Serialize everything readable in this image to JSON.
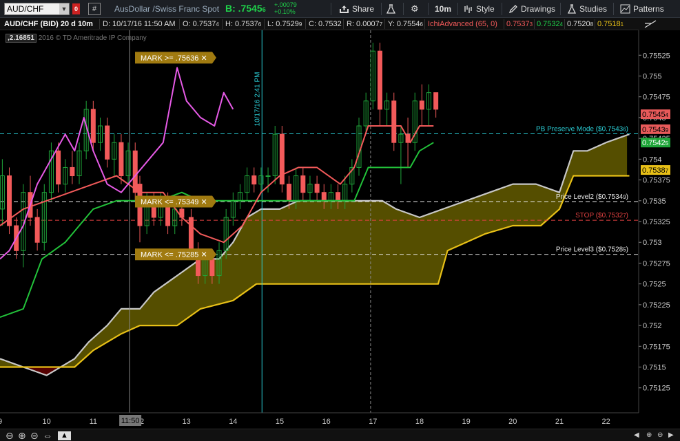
{
  "toolbar": {
    "symbol": "AUD/CHF",
    "link_badge": "0",
    "description": "AusDollar /Swiss Franc Spot",
    "bid_label": "B: .7545",
    "bid_sub": "6",
    "change_abs": "+.00079",
    "change_pct": "+0.10%",
    "share": "Share",
    "period": "10m",
    "style": "Style",
    "drawings": "Drawings",
    "studies": "Studies",
    "patterns": "Patterns"
  },
  "infobar": {
    "title": "AUD/CHF (BID) 20 d 10m",
    "date": "D: 10/17/16 11:50 AM",
    "open": "O: 0.7537",
    "open_sub": "4",
    "high": "H: 0.7537",
    "high_sub": "6",
    "low": "L: 0.7529",
    "low_sub": "9",
    "close": "C: 0.7532",
    "range": "R: 0.0007",
    "range_sub": "7",
    "y": "Y: 0.7554",
    "y_sub": "6",
    "study": "IchiAdvanced (65, 0)",
    "s1": "0.7537",
    "s1_sub": "3",
    "s2": "0.7532",
    "s2_sub": "4",
    "s3": "0.7520",
    "s3_sub": "8",
    "s4": "0.7518",
    "s4_sub": "1"
  },
  "copyright": {
    "value": ",2.16851",
    "text": "2016 © TD Ameritrade IP Company"
  },
  "chart_data": {
    "type": "candlestick",
    "ylim": [
      0.75095,
      0.75555
    ],
    "xlim": [
      9,
      22.7
    ],
    "y_ticks": [
      "0.75525",
      "0.755",
      "0.75475",
      "0.7545",
      "0.75425",
      "0.754",
      "0.75375",
      "0.7535",
      "0.75325",
      "0.753",
      "0.75275",
      "0.7525",
      "0.75225",
      "0.752",
      "0.75175",
      "0.7515",
      "0.75125"
    ],
    "x_ticks": [
      "9",
      "10",
      "11",
      "12",
      "13",
      "14",
      "15",
      "16",
      "17",
      "18",
      "19",
      "20",
      "21",
      "22"
    ],
    "crosshair_x_label": "11:50",
    "vertical_event_label": "10/17/16 2:41 PM",
    "candles": [
      [
        9.05,
        0.7534,
        0.7538,
        0.7532,
        0.754
      ],
      [
        9.2,
        0.7538,
        0.7532,
        0.7531,
        0.7539
      ],
      [
        9.35,
        0.7532,
        0.7529,
        0.7528,
        0.7533
      ],
      [
        9.5,
        0.7529,
        0.7536,
        0.7527,
        0.7537
      ],
      [
        9.65,
        0.7536,
        0.7533,
        0.7532,
        0.7538
      ],
      [
        9.8,
        0.7533,
        0.753,
        0.7529,
        0.7534
      ],
      [
        9.95,
        0.753,
        0.7536,
        0.7529,
        0.7537
      ],
      [
        10.1,
        0.7536,
        0.7541,
        0.7535,
        0.7542
      ],
      [
        10.25,
        0.7541,
        0.7537,
        0.7536,
        0.7542
      ],
      [
        10.4,
        0.7537,
        0.7539,
        0.7536,
        0.754
      ],
      [
        10.55,
        0.7539,
        0.7538,
        0.7537,
        0.7541
      ],
      [
        10.7,
        0.7538,
        0.7541,
        0.7537,
        0.7542
      ],
      [
        10.85,
        0.7541,
        0.7546,
        0.754,
        0.7547
      ],
      [
        11.0,
        0.7546,
        0.7542,
        0.7541,
        0.7547
      ],
      [
        11.15,
        0.7542,
        0.7544,
        0.7541,
        0.7545
      ],
      [
        11.3,
        0.7544,
        0.754,
        0.7539,
        0.7545
      ],
      [
        11.45,
        0.754,
        0.7542,
        0.7538,
        0.7543
      ],
      [
        11.6,
        0.7542,
        0.7538,
        0.7537,
        0.7543
      ],
      [
        11.75,
        0.7538,
        0.7541,
        0.7537,
        0.7542
      ],
      [
        11.9,
        0.7541,
        0.7536,
        0.7535,
        0.7542
      ],
      [
        12.0,
        0.7537,
        0.7532,
        0.753,
        0.7538
      ],
      [
        12.15,
        0.7532,
        0.7535,
        0.7531,
        0.7536
      ],
      [
        12.3,
        0.7535,
        0.7533,
        0.7532,
        0.7536
      ],
      [
        12.45,
        0.7533,
        0.7535,
        0.7532,
        0.7536
      ],
      [
        12.6,
        0.7535,
        0.7532,
        0.7531,
        0.7536
      ],
      [
        12.75,
        0.7532,
        0.7534,
        0.7531,
        0.7535
      ],
      [
        12.9,
        0.7534,
        0.7533,
        0.7532,
        0.7535
      ],
      [
        13.1,
        0.7533,
        0.7529,
        0.7528,
        0.7534
      ],
      [
        13.25,
        0.7529,
        0.7526,
        0.7525,
        0.753
      ],
      [
        13.4,
        0.7526,
        0.7528,
        0.7525,
        0.7529
      ],
      [
        13.55,
        0.7528,
        0.7526,
        0.7525,
        0.7529
      ],
      [
        13.7,
        0.7526,
        0.7529,
        0.7525,
        0.753
      ],
      [
        13.85,
        0.7529,
        0.7533,
        0.7528,
        0.7534
      ],
      [
        14.0,
        0.7533,
        0.7535,
        0.7532,
        0.7536
      ],
      [
        14.15,
        0.7535,
        0.7536,
        0.7534,
        0.7537
      ],
      [
        14.3,
        0.7536,
        0.7538,
        0.7535,
        0.7539
      ],
      [
        14.45,
        0.7538,
        0.7537,
        0.7536,
        0.7539
      ],
      [
        14.6,
        0.7537,
        0.7538,
        0.7536,
        0.7539
      ],
      [
        14.75,
        0.7538,
        0.7538,
        0.7536,
        0.7539
      ],
      [
        14.9,
        0.7538,
        0.7543,
        0.7537,
        0.7544
      ],
      [
        15.05,
        0.7543,
        0.7537,
        0.7536,
        0.7544
      ],
      [
        15.2,
        0.7537,
        0.7535,
        0.7534,
        0.7538
      ],
      [
        15.35,
        0.7535,
        0.7538,
        0.7534,
        0.7539
      ],
      [
        15.5,
        0.7538,
        0.7536,
        0.7535,
        0.7539
      ],
      [
        15.65,
        0.7536,
        0.7537,
        0.7535,
        0.7538
      ],
      [
        15.8,
        0.7537,
        0.7536,
        0.7535,
        0.7538
      ],
      [
        15.95,
        0.7536,
        0.7535,
        0.7534,
        0.7537
      ],
      [
        16.1,
        0.7535,
        0.7536,
        0.7534,
        0.7537
      ],
      [
        16.25,
        0.7536,
        0.7535,
        0.7534,
        0.7537
      ],
      [
        16.4,
        0.7535,
        0.7537,
        0.7534,
        0.7538
      ],
      [
        16.55,
        0.7537,
        0.7539,
        0.7536,
        0.754
      ],
      [
        16.7,
        0.7539,
        0.7544,
        0.7538,
        0.7545
      ],
      [
        16.85,
        0.7544,
        0.7547,
        0.7543,
        0.7548
      ],
      [
        17.0,
        0.7547,
        0.7553,
        0.7546,
        0.7554
      ],
      [
        17.15,
        0.7553,
        0.7546,
        0.7544,
        0.7554
      ],
      [
        17.3,
        0.7546,
        0.7547,
        0.7544,
        0.7548
      ],
      [
        17.45,
        0.7547,
        0.7542,
        0.7541,
        0.7548
      ],
      [
        17.6,
        0.7542,
        0.7543,
        0.7537,
        0.7544
      ],
      [
        17.75,
        0.7543,
        0.7542,
        0.7539,
        0.7545
      ],
      [
        17.9,
        0.7542,
        0.7547,
        0.7541,
        0.7548
      ],
      [
        18.05,
        0.7547,
        0.7546,
        0.7544,
        0.7549
      ],
      [
        18.2,
        0.7546,
        0.7548,
        0.7544,
        0.7549
      ],
      [
        18.35,
        0.7548,
        0.7546,
        0.7545,
        0.7548
      ]
    ],
    "ichimoku": {
      "span_a": [
        [
          9,
          0.7516
        ],
        [
          9.5,
          0.7515
        ],
        [
          10,
          0.7514
        ],
        [
          10.6,
          0.7516
        ],
        [
          10.9,
          0.7518
        ],
        [
          11.3,
          0.752
        ],
        [
          11.6,
          0.7522
        ],
        [
          12.0,
          0.7522
        ],
        [
          12.3,
          0.7524
        ],
        [
          12.8,
          0.7526
        ],
        [
          13.3,
          0.7528
        ],
        [
          13.7,
          0.7528
        ],
        [
          14.0,
          0.753
        ],
        [
          14.3,
          0.7533
        ],
        [
          14.6,
          0.7534
        ],
        [
          15.0,
          0.7534
        ],
        [
          15.4,
          0.7535
        ],
        [
          15.8,
          0.7535
        ],
        [
          16.3,
          0.7535
        ],
        [
          16.6,
          0.7535
        ],
        [
          17.0,
          0.7535
        ],
        [
          17.2,
          0.7535
        ],
        [
          17.5,
          0.7534
        ],
        [
          18.0,
          0.7533
        ],
        [
          18.5,
          0.7534
        ],
        [
          19.0,
          0.7535
        ],
        [
          19.5,
          0.7536
        ],
        [
          20.0,
          0.7537
        ],
        [
          20.5,
          0.7537
        ],
        [
          21.0,
          0.7536
        ],
        [
          21.3,
          0.7541
        ],
        [
          21.6,
          0.7541
        ],
        [
          22.0,
          0.7542
        ],
        [
          22.5,
          0.7543
        ]
      ],
      "span_b": [
        [
          9,
          0.7515
        ],
        [
          10.6,
          0.7515
        ],
        [
          11,
          0.7517
        ],
        [
          11.6,
          0.7519
        ],
        [
          12.0,
          0.752
        ],
        [
          12.8,
          0.752
        ],
        [
          13.3,
          0.7522
        ],
        [
          14.0,
          0.7523
        ],
        [
          14.5,
          0.7525
        ],
        [
          15.0,
          0.7525
        ],
        [
          16.0,
          0.7525
        ],
        [
          17.0,
          0.7525
        ],
        [
          18.0,
          0.7525
        ],
        [
          18.4,
          0.7525
        ],
        [
          18.6,
          0.7529
        ],
        [
          19.0,
          0.753
        ],
        [
          19.4,
          0.7531
        ],
        [
          20.0,
          0.7532
        ],
        [
          20.6,
          0.7532
        ],
        [
          21.0,
          0.7534
        ],
        [
          21.3,
          0.7538
        ],
        [
          21.6,
          0.7538
        ],
        [
          22.0,
          0.7538
        ],
        [
          22.5,
          0.7538
        ]
      ],
      "tenkan": [
        [
          9.0,
          0.7532
        ],
        [
          9.5,
          0.7534
        ],
        [
          10.0,
          0.7535
        ],
        [
          10.5,
          0.7536
        ],
        [
          11.0,
          0.7537
        ],
        [
          11.5,
          0.7538
        ],
        [
          12.0,
          0.7536
        ],
        [
          12.5,
          0.7536
        ],
        [
          12.9,
          0.7533
        ],
        [
          13.3,
          0.7531
        ],
        [
          13.8,
          0.753
        ],
        [
          14.2,
          0.7532
        ],
        [
          14.6,
          0.7536
        ],
        [
          15.0,
          0.7538
        ],
        [
          15.4,
          0.7539
        ],
        [
          15.8,
          0.7539
        ],
        [
          16.3,
          0.7537
        ],
        [
          16.6,
          0.7539
        ],
        [
          16.9,
          0.7544
        ],
        [
          17.3,
          0.7544
        ],
        [
          17.6,
          0.7544
        ],
        [
          17.8,
          0.7542
        ],
        [
          18.0,
          0.7544
        ],
        [
          18.3,
          0.7544
        ]
      ],
      "kijun": [
        [
          9.0,
          0.7521
        ],
        [
          9.5,
          0.7522
        ],
        [
          9.9,
          0.7528
        ],
        [
          10.4,
          0.753
        ],
        [
          10.7,
          0.7532
        ],
        [
          11.0,
          0.7534
        ],
        [
          11.5,
          0.7535
        ],
        [
          12.0,
          0.7535
        ],
        [
          12.4,
          0.7535
        ],
        [
          12.9,
          0.7536
        ],
        [
          13.3,
          0.7535
        ],
        [
          13.8,
          0.7535
        ],
        [
          14.2,
          0.7535
        ],
        [
          14.6,
          0.7535
        ],
        [
          15.0,
          0.7535
        ],
        [
          15.5,
          0.7535
        ],
        [
          16.0,
          0.7535
        ],
        [
          16.6,
          0.7535
        ],
        [
          16.9,
          0.7539
        ],
        [
          17.3,
          0.7539
        ],
        [
          17.8,
          0.7539
        ],
        [
          18.0,
          0.7541
        ],
        [
          18.3,
          0.7542
        ]
      ],
      "chikou": [
        [
          9.0,
          0.7528
        ],
        [
          9.2,
          0.7529
        ],
        [
          9.5,
          0.7532
        ],
        [
          9.8,
          0.7537
        ],
        [
          10.1,
          0.754
        ],
        [
          10.4,
          0.7543
        ],
        [
          10.6,
          0.7541
        ],
        [
          10.8,
          0.7545
        ],
        [
          11.0,
          0.7541
        ],
        [
          11.3,
          0.7537
        ],
        [
          11.6,
          0.7536
        ],
        [
          11.9,
          0.7538
        ],
        [
          12.2,
          0.754
        ],
        [
          12.5,
          0.7542
        ],
        [
          12.8,
          0.7551
        ],
        [
          13.0,
          0.7547
        ],
        [
          13.3,
          0.7545
        ],
        [
          13.6,
          0.7544
        ],
        [
          13.8,
          0.7548
        ],
        [
          14.0,
          0.7546
        ]
      ]
    },
    "price_lines": [
      {
        "label": "PB Preserve Mode ($0.7543",
        "sub": "6",
        "value": 0.754305,
        "color": "#2bd0d8"
      },
      {
        "label": "Price Level2 ($0.7534",
        "sub": "9",
        "value": 0.75349,
        "color": "#e8e8e8"
      },
      {
        "label": "STOP ($0.7532",
        "sub": "7",
        "value": 0.753265,
        "color": "#e04040"
      },
      {
        "label": "Price Level3 ($0.7528",
        "sub": "5",
        "value": 0.752855,
        "color": "#e8e8e8"
      }
    ],
    "marks": [
      {
        "label": "MARK >= .75636",
        "value": 0.75522
      },
      {
        "label": "MARK <= .75349",
        "value": 0.75349
      },
      {
        "label": "MARK <= .75285",
        "value": 0.752855
      }
    ],
    "price_badges": [
      {
        "value": "0.7545",
        "sub": "4",
        "y": 0.75454,
        "bg": "#e85a5a",
        "fg": "#000"
      },
      {
        "value": "0.7543",
        "sub": "9",
        "y": 0.75436,
        "bg": "#e85a5a",
        "fg": "#000"
      },
      {
        "value": "0.7542",
        "sub": "5",
        "y": 0.7542,
        "bg": "#1fa63a",
        "fg": "#fff"
      },
      {
        "value": "0.7538",
        "sub": "7",
        "y": 0.75387,
        "bg": "#e8c017",
        "fg": "#000"
      }
    ],
    "colors": {
      "up": "#1fa63a",
      "down": "#f25a5a",
      "cloud": "#5a5200",
      "cloud_bear": "#5a0000",
      "span_a": "#c8c8c8",
      "span_b": "#e8c017",
      "tenkan": "#f25a5a",
      "kijun": "#22c23a",
      "chikou": "#e65ae6"
    }
  }
}
